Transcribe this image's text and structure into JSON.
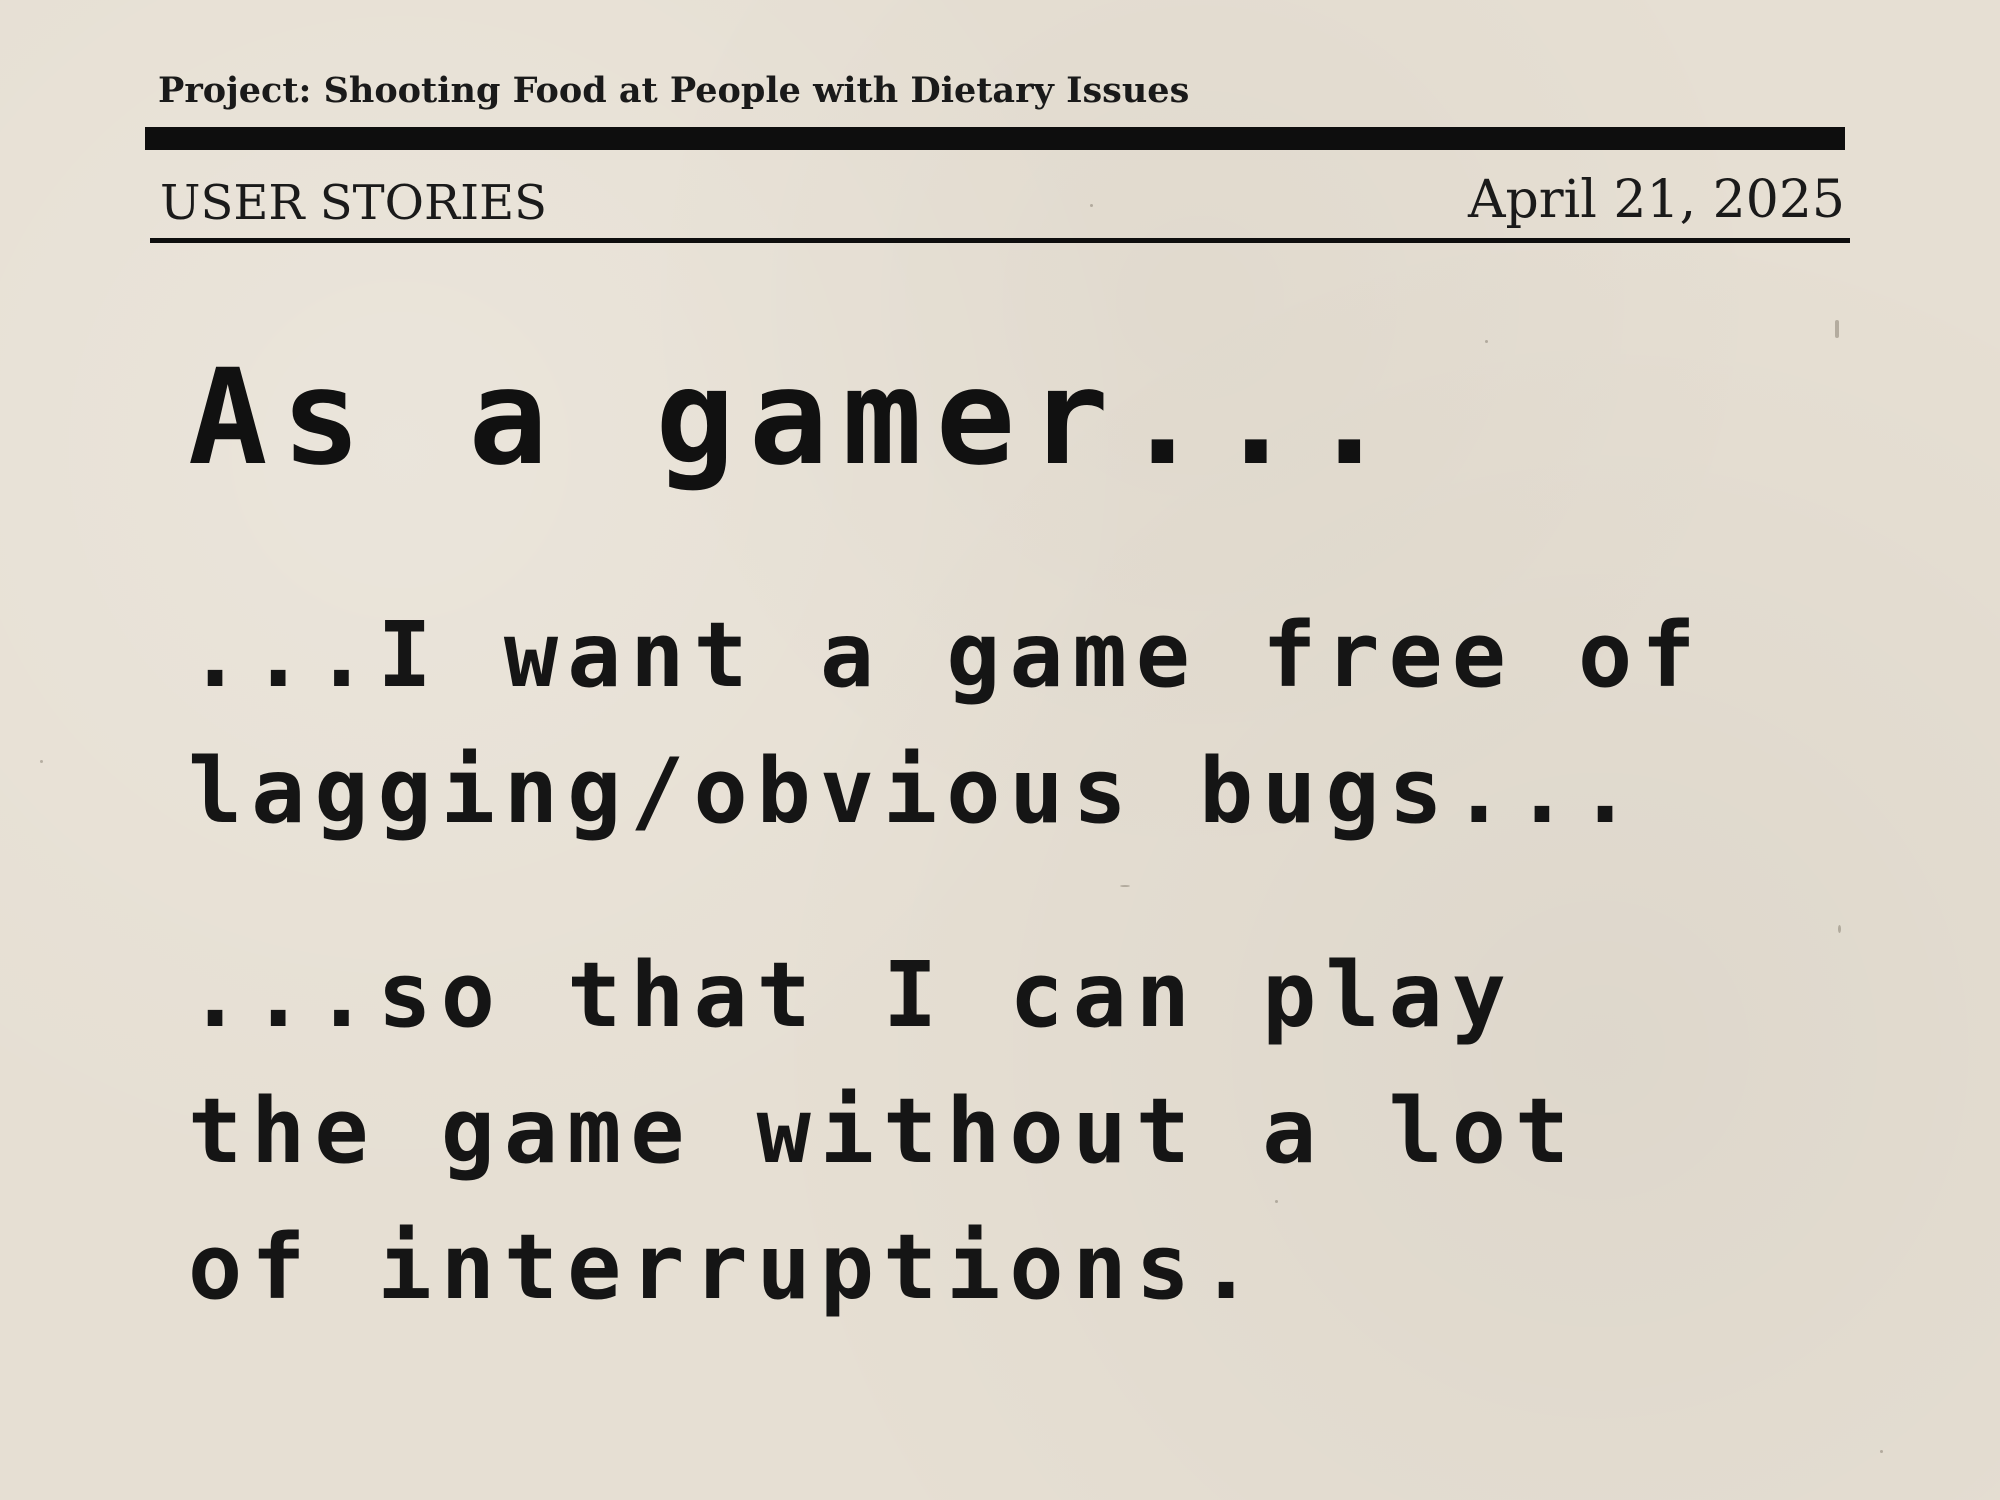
{
  "header": {
    "project": "Project: Shooting Food at People with Dietary Issues",
    "section": "USER STORIES",
    "date": "April 21, 2025"
  },
  "story": {
    "heading": "As a gamer...",
    "want_lines": [
      "...I want a game free of",
      "lagging/obvious bugs..."
    ],
    "so_that_lines": [
      "...so that I can play",
      "the game without a lot",
      "of interruptions."
    ]
  }
}
